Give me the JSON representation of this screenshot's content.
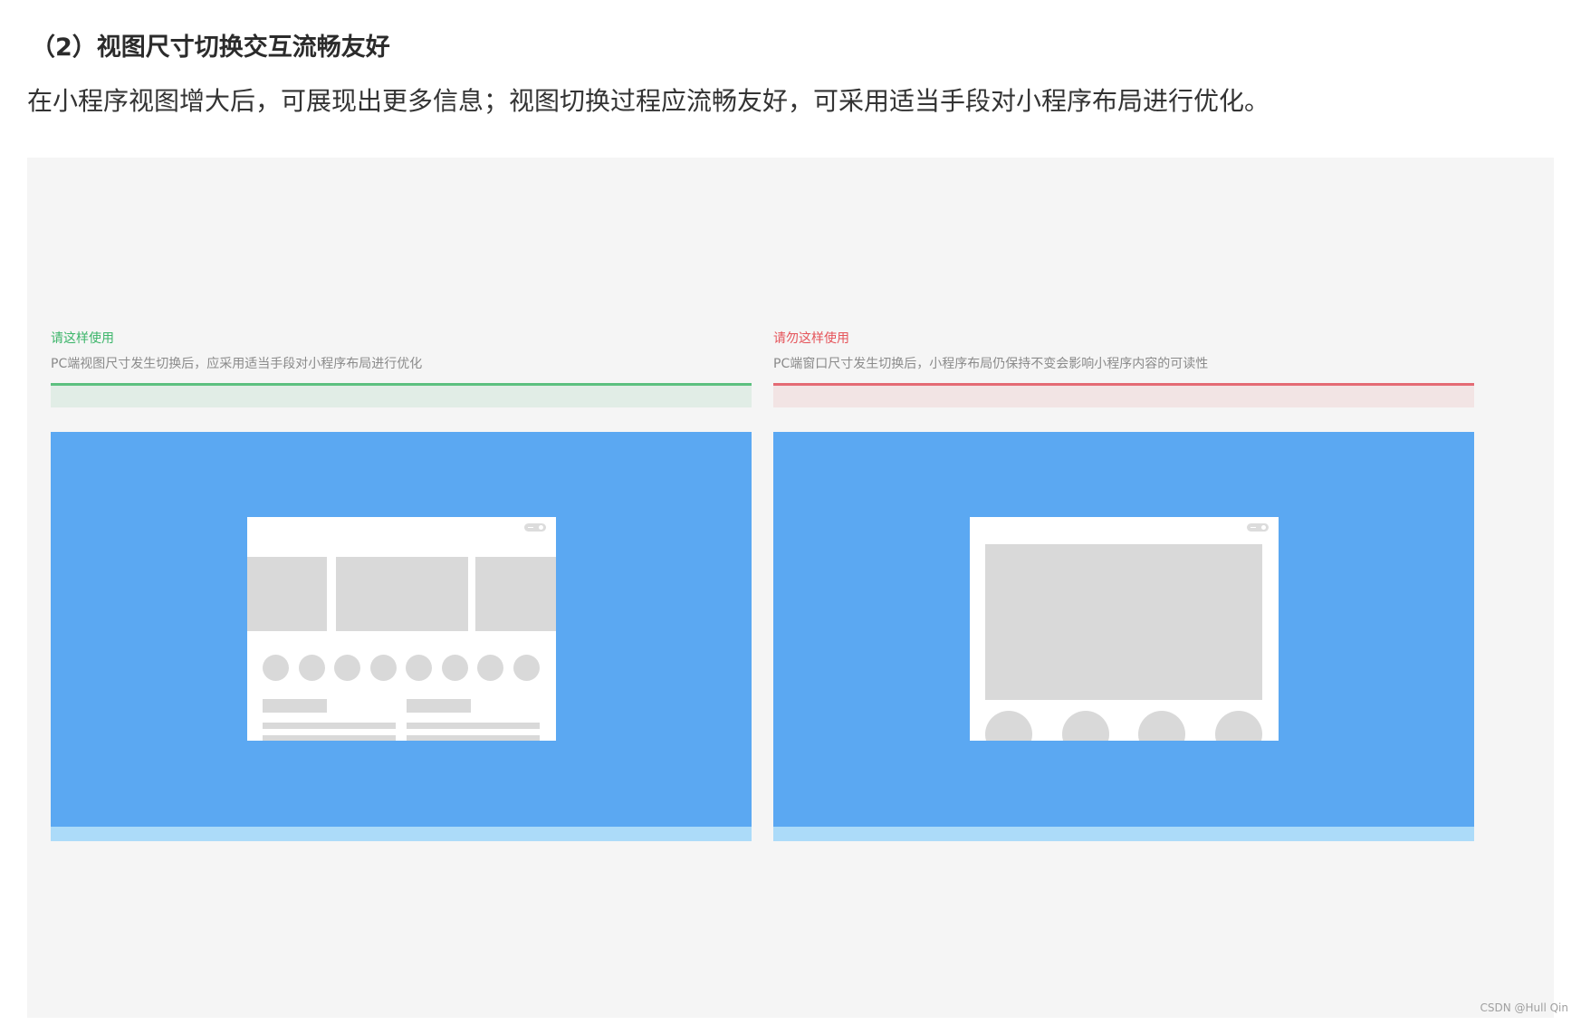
{
  "section": {
    "title": "（2）视图尺寸切换交互流畅友好",
    "description": "在小程序视图增大后，可展现出更多信息；视图切换过程应流畅友好，可采用适当手段对小程序布局进行优化。"
  },
  "panels": [
    {
      "verdict": "请这样使用",
      "note": "PC端视图尺寸发生切换后，应采用适当手段对小程序布局进行优化",
      "accent_color": "#3cb56a"
    },
    {
      "verdict": "请勿这样使用",
      "note": "PC端窗口尺寸发生切换后，小程序布局仍保持不变会影响小程序内容的可读性",
      "accent_color": "#e5545a"
    }
  ],
  "colors": {
    "stage_background": "#5ba8f2",
    "stage_footer": "#acdbf9",
    "placeholder": "#d9d9d9",
    "figure_background": "#f5f5f5"
  },
  "watermark": "CSDN @Hull Qin"
}
